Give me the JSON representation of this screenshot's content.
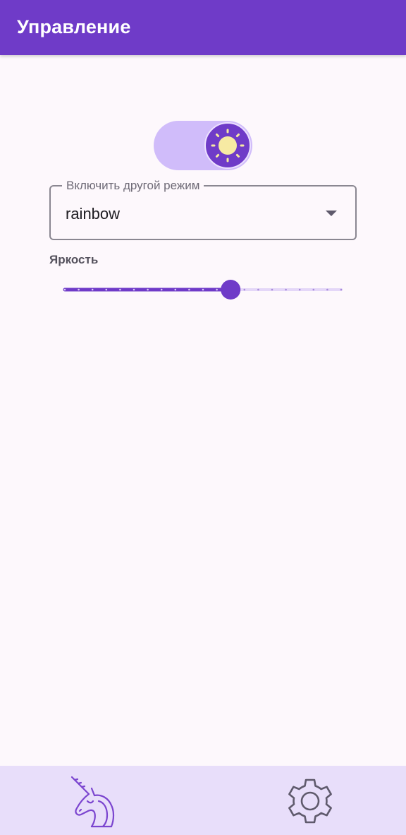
{
  "app_bar": {
    "title": "Управление"
  },
  "mode_toggle": {
    "state": "on",
    "icon": "sun-icon"
  },
  "mode_select": {
    "label": "Включить другой режим",
    "value": "rainbow"
  },
  "brightness": {
    "label": "Яркость",
    "value_fraction": 0.6,
    "steps": 20
  },
  "bottom_nav": {
    "items": [
      {
        "icon": "unicorn-icon"
      },
      {
        "icon": "gear-icon"
      }
    ]
  },
  "colors": {
    "primary": "#6f3bc8",
    "primary_container": "#d0bcfa",
    "background": "#fdf8fc",
    "nav_background": "#e8defa",
    "sun": "#f7eaa3"
  }
}
